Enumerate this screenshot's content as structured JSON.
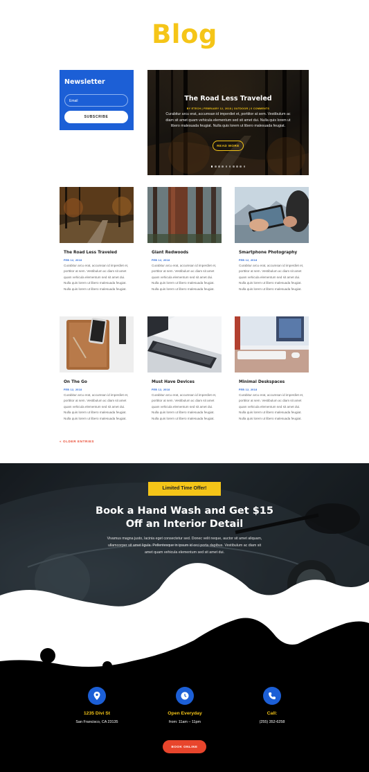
{
  "page": {
    "title": "Blog"
  },
  "newsletter": {
    "title": "Newsletter",
    "email_placeholder": "Email",
    "subscribe_label": "SUBSCRIBE"
  },
  "hero": {
    "title": "The Road Less Traveled",
    "meta": "BY ETECH | FEBRUARY 12, 2018 | OUTDOOR | 0 COMMENTS",
    "text": "Curabitur arcu erat, accumsan id imperdiet et, porttitor at sem. Vestibulum ac diam sit amet quam vehicula elementum sed sit amet dui. Nulla quis lorem ut libero malesuada feugiat. Nulla quis lorem ut libero malesuada feugiat.",
    "button_label": "READ MORE",
    "slides": 10,
    "active_slide": 1
  },
  "posts": [
    {
      "title": "The Road Less Traveled",
      "date": "FEB 12, 2018",
      "excerpt": "Curabitur arcu erat, accumsan id imperdiet et, porttitor at sem. Vestibulum ac diam sit amet quam vehicula elementum sed sit amet dui. Nulla quis lorem ut libero malesuada feugiat. Nulla quis lorem ut libero malesuada feugiat."
    },
    {
      "title": "Giant Redwoods",
      "date": "FEB 12, 2018",
      "excerpt": "Curabitur arcu erat, accumsan id imperdiet et, porttitor at sem. Vestibulum ac diam sit amet quam vehicula elementum sed sit amet dui. Nulla quis lorem ut libero malesuada feugiat. Nulla quis lorem ut libero malesuada feugiat."
    },
    {
      "title": "Smartphone Photography",
      "date": "FEB 12, 2018",
      "excerpt": "Curabitur arcu erat, accumsan id imperdiet et, porttitor at sem. Vestibulum ac diam sit amet quam vehicula elementum sed sit amet dui. Nulla quis lorem ut libero malesuada feugiat. Nulla quis lorem ut libero malesuada feugiat."
    },
    {
      "title": "On The Go",
      "date": "FEB 12, 2018",
      "excerpt": "Curabitur arcu erat, accumsan id imperdiet et, porttitor at sem. Vestibulum ac diam sit amet quam vehicula elementum sed sit amet dui. Nulla quis lorem ut libero malesuada feugiat. Nulla quis lorem ut libero malesuada feugiat."
    },
    {
      "title": "Must Have Devices",
      "date": "FEB 12, 2018",
      "excerpt": "Curabitur arcu erat, accumsan id imperdiet et, porttitor at sem. Vestibulum ac diam sit amet quam vehicula elementum sed sit amet dui. Nulla quis lorem ut libero malesuada feugiat. Nulla quis lorem ut libero malesuada feugiat."
    },
    {
      "title": "Minimal Deskspaces",
      "date": "FEB 12, 2018",
      "excerpt": "Curabitur arcu erat, accumsan id imperdiet et, porttitor at sem. Vestibulum ac diam sit amet quam vehicula elementum sed sit amet dui. Nulla quis lorem ut libero malesuada feugiat. Nulla quis lorem ut libero malesuada feugiat."
    }
  ],
  "pagination": {
    "older_label": "« OLDER ENTRIES"
  },
  "promo": {
    "badge": "Limited Time Offer!",
    "headline": "Book a Hand Wash and Get $15 Off an Interior Detail",
    "text": "Vivamus magna justo, lacinia eget consectetur sed. Donec velit neque, auctor sit amet aliquam, ullamcorper sit amet ligula. Pellentesque in ipsum id orci porta dapibus. Vestibulum ac diam sit amet quam vehicula elementum sed sit amet dui."
  },
  "info": [
    {
      "icon": "map-pin-icon",
      "title": "1235 Divi St",
      "subtitle": "San Francisco, CA 23135"
    },
    {
      "icon": "clock-icon",
      "title": "Open Everyday",
      "subtitle": "from: 11am – 11pm"
    },
    {
      "icon": "phone-icon",
      "title": "Call:",
      "subtitle": "(255) 352-6258"
    }
  ],
  "footer": {
    "book_label": "BOOK ONLINE"
  },
  "colors": {
    "accent_yellow": "#f5c518",
    "brand_blue": "#1c5fd6",
    "cta_orange": "#e8452c"
  }
}
